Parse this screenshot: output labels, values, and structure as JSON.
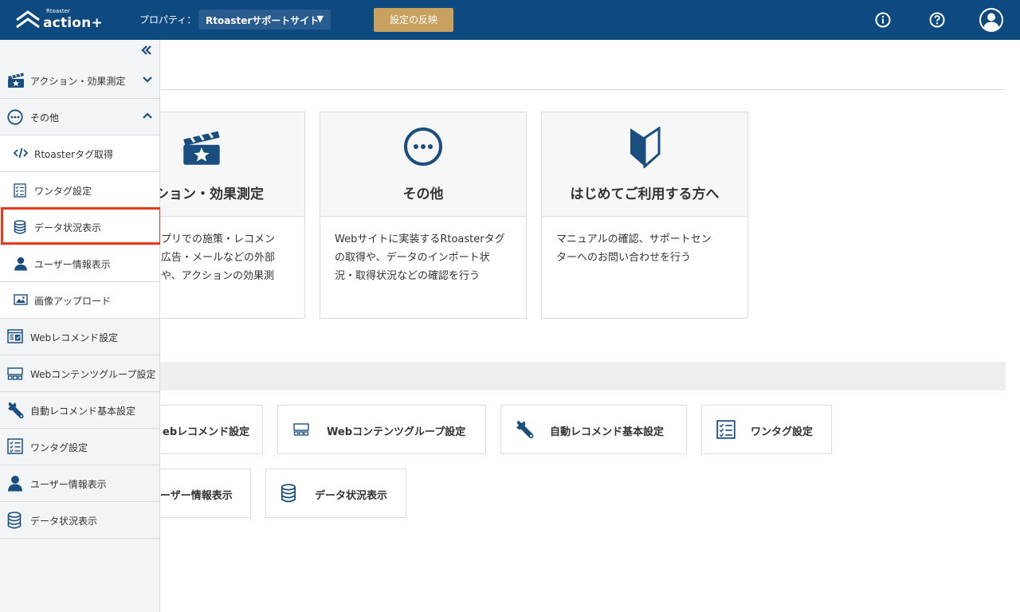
{
  "header": {
    "logo_small": "Rtoaster",
    "logo_text": "action+",
    "property_label": "プロパティ：",
    "property_value": "Rtoasterサポートサイト",
    "apply_button": "設定の反映",
    "icons": [
      "info-icon",
      "help-icon",
      "user-avatar-icon"
    ]
  },
  "sidebar": {
    "items": [
      {
        "label": "アクション・効果測定",
        "icon": "clapperboard-icon",
        "chevron": "down"
      },
      {
        "label": "その他",
        "icon": "more-circle-icon",
        "chevron": "up"
      },
      {
        "label": "Rtoasterタグ取得",
        "icon": "code-icon",
        "sub": true
      },
      {
        "label": "ワンタグ設定",
        "icon": "checklist-icon",
        "sub": true
      },
      {
        "label": "データ状況表示",
        "icon": "database-icon",
        "sub": true,
        "selected": true
      },
      {
        "label": "ユーザー情報表示",
        "icon": "user-icon",
        "sub": true
      },
      {
        "label": "画像アップロード",
        "icon": "image-icon",
        "sub": true
      },
      {
        "label": "Webレコメンド設定",
        "icon": "web-recommend-icon"
      },
      {
        "label": "Webコンテンツグループ設定",
        "icon": "content-group-icon"
      },
      {
        "label": "自動レコメンド基本設定",
        "icon": "wrench-icon"
      },
      {
        "label": "ワンタグ設定",
        "icon": "checklist-icon"
      },
      {
        "label": "ユーザー情報表示",
        "icon": "user-icon"
      },
      {
        "label": "データ状況表示",
        "icon": "database-icon"
      }
    ]
  },
  "cards": [
    {
      "title": "ション・効果測定",
      "desc": [
        "プリでの施策・レコメン",
        "広告・メールなどの外部",
        "や、アクションの効果測"
      ],
      "icon": "clapperboard-icon"
    },
    {
      "title": "その他",
      "desc": [
        "Webサイトに実装するRtoasterタグ",
        "の取得や、データのインポート状",
        "況・取得状況などの確認を行う"
      ],
      "icon": "more-circle-icon"
    },
    {
      "title": "はじめてご利用する方へ",
      "desc": [
        "マニュアルの確認、サポートセン",
        "ターへのお問い合わせを行う"
      ],
      "icon": "beginner-mark-icon"
    }
  ],
  "quick_links": [
    {
      "label": "ebレコメンド設定",
      "icon": "web-recommend-icon"
    },
    {
      "label": "Webコンテンツグループ設定",
      "icon": "content-group-icon"
    },
    {
      "label": "自動レコメンド基本設定",
      "icon": "wrench-icon"
    },
    {
      "label": "ワンタグ設定",
      "icon": "checklist-icon"
    },
    {
      "label": "ーザー情報表示",
      "icon": "user-icon"
    },
    {
      "label": "データ状況表示",
      "icon": "database-icon"
    }
  ],
  "colors": {
    "header": "#0e4a80",
    "accent_blue": "#1a4e7e",
    "apply": "#c9a15f",
    "highlight": "#e8381e"
  }
}
